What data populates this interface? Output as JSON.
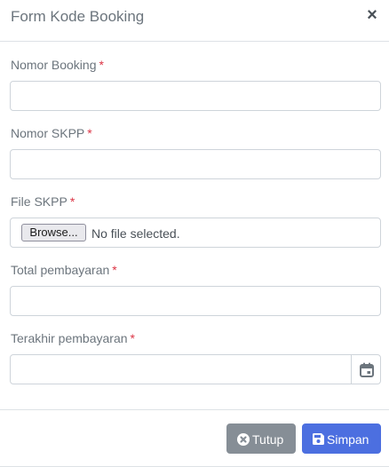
{
  "modal": {
    "title": "Form Kode Booking",
    "close_icon": "×"
  },
  "form": {
    "fields": [
      {
        "label": "Nomor Booking",
        "required_mark": "*",
        "value": "",
        "placeholder": ""
      },
      {
        "label": "Nomor SKPP",
        "required_mark": "*",
        "value": "",
        "placeholder": ""
      },
      {
        "label": "File SKPP",
        "required_mark": "*",
        "browse_label": "Browse...",
        "file_status": "No file selected."
      },
      {
        "label": "Total pembayaran",
        "required_mark": "*",
        "value": "",
        "placeholder": ""
      },
      {
        "label": "Terakhir pembayaran",
        "required_mark": "*",
        "value": "",
        "placeholder": "",
        "icon": "calendar-icon"
      }
    ]
  },
  "footer": {
    "close_label": "Tutup",
    "close_icon": "times-circle-icon",
    "save_label": "Simpan",
    "save_icon": "floppy-disk-icon"
  },
  "colors": {
    "primary": "#4c6fe0",
    "secondary": "#868e96",
    "required": "#dc3545",
    "border": "#ced4da"
  }
}
